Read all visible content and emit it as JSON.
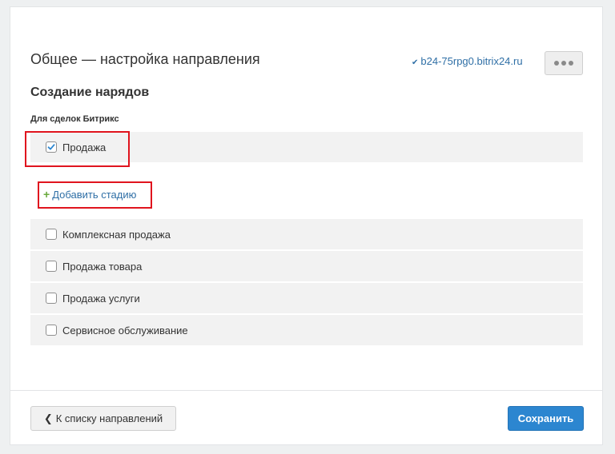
{
  "header": {
    "title": "Общее — настройка направления",
    "portal_check_icon": "✔",
    "portal_link": "b24-75rpg0.bitrix24.ru",
    "more_icon": "more-dots-icon"
  },
  "section": {
    "title": "Создание нарядов",
    "group_label": "Для сделок Битрикс"
  },
  "stages_selected": [
    {
      "label": "Продажа",
      "checked": true
    }
  ],
  "add_stage": {
    "plus": "+",
    "label": "Добавить стадию"
  },
  "pipelines": [
    {
      "label": "Комплексная продажа",
      "checked": false
    },
    {
      "label": "Продажа товара",
      "checked": false
    },
    {
      "label": "Продажа услуги",
      "checked": false
    },
    {
      "label": "Сервисное обслуживание",
      "checked": false
    }
  ],
  "footer": {
    "back_chevron": "❮",
    "back_label": "К списку направлений",
    "save_label": "Сохранить"
  },
  "colors": {
    "accent": "#2c86d0",
    "link": "#2f6fa6",
    "highlight": "#e0141e",
    "plus": "#6aaa3d"
  }
}
